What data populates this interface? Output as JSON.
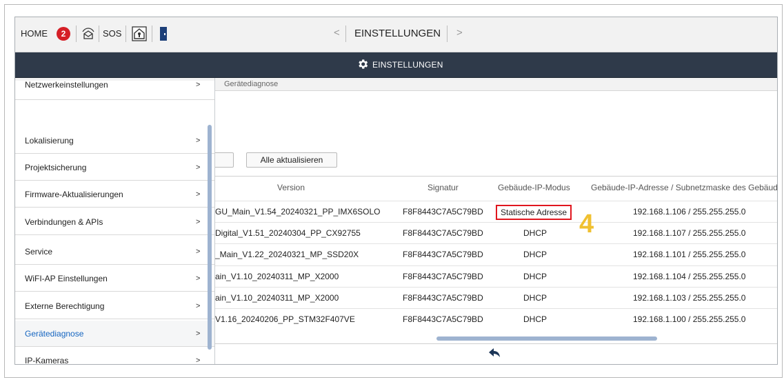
{
  "topbar": {
    "home_label": "HOME",
    "notification_count": "2",
    "sos_label": "SOS",
    "title": "EINSTELLUNGEN",
    "prev_arrow": "<",
    "next_arrow": ">"
  },
  "header": {
    "title": "EINSTELLUNGEN"
  },
  "left_panel": {
    "header": "Einstellungen",
    "items": [
      {
        "label": "Netzwerkeinstellungen"
      },
      {
        "label": "Lokalisierung"
      },
      {
        "label": "Projektsicherung"
      },
      {
        "label": "Firmware-Aktualisierungen"
      },
      {
        "label": "Verbindungen & APIs"
      },
      {
        "label": "Service"
      },
      {
        "label": "WiFI-AP Einstellungen"
      },
      {
        "label": "Externe Berechtigung"
      },
      {
        "label": "Gerätediagnose"
      },
      {
        "label": "IP-Kameras"
      }
    ],
    "chevron": ">"
  },
  "right_panel": {
    "header": "Gerätediagnose",
    "update_all_label": "Alle aktualisieren",
    "columns": [
      "Version",
      "Signatur",
      "Gebäude-IP-Modus",
      "Gebäude-IP-Adresse / Subnetzmaske des Gebäudes"
    ],
    "rows": [
      {
        "version": "GU_Main_V1.54_20240321_PP_IMX6SOLO",
        "signature": "F8F8443C7A5C79BD",
        "mode": "Statische Adresse",
        "ip": "192.168.1.106 / 255.255.255.0"
      },
      {
        "version": "Digital_V1.51_20240304_PP_CX92755",
        "signature": "F8F8443C7A5C79BD",
        "mode": "DHCP",
        "ip": "192.168.1.107 / 255.255.255.0"
      },
      {
        "version": "_Main_V1.22_20240321_MP_SSD20X",
        "signature": "F8F8443C7A5C79BD",
        "mode": "DHCP",
        "ip": "192.168.1.101 / 255.255.255.0"
      },
      {
        "version": "ain_V1.10_20240311_MP_X2000",
        "signature": "F8F8443C7A5C79BD",
        "mode": "DHCP",
        "ip": "192.168.1.104 / 255.255.255.0"
      },
      {
        "version": "ain_V1.10_20240311_MP_X2000",
        "signature": "F8F8443C7A5C79BD",
        "mode": "DHCP",
        "ip": "192.168.1.103 / 255.255.255.0"
      },
      {
        "version": "V1.16_20240206_PP_STM32F407VE",
        "signature": "F8F8443C7A5C79BD",
        "mode": "DHCP",
        "ip": "192.168.1.100 / 255.255.255.0"
      }
    ],
    "callout": "4"
  },
  "colors": {
    "header_bg": "#2f3a4a",
    "badge": "#d51f26",
    "highlight_border": "#e0161e",
    "callout": "#f0c030",
    "active_item": "#1565c0",
    "scrollbar": "#9eb3d0"
  },
  "icons": {
    "mail": "envelope-broadcast-icon",
    "home_lock": "house-lock-icon",
    "door": "door-icon",
    "gear": "gear-icon",
    "back": "back-arrow-icon"
  }
}
